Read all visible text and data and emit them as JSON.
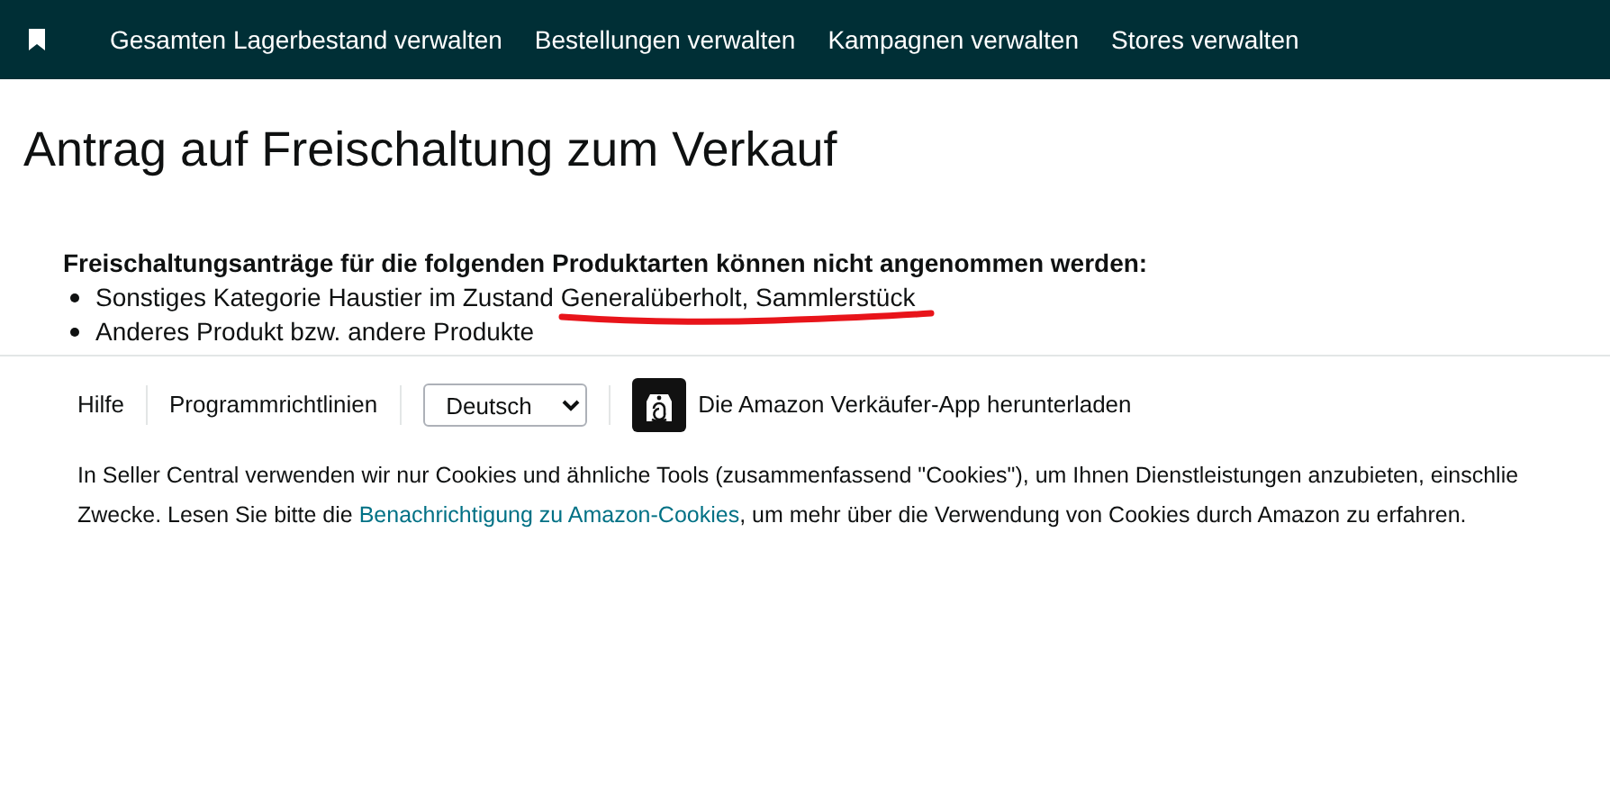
{
  "nav": {
    "items": [
      "Gesamten Lagerbestand verwalten",
      "Bestellungen verwalten",
      "Kampagnen verwalten",
      "Stores verwalten"
    ]
  },
  "title": "Antrag auf Freischaltung zum Verkauf",
  "notice": {
    "heading": "Freischaltungsanträge für die folgenden Produktarten können nicht angenommen werden:",
    "items": [
      "Sonstiges Kategorie Haustier im Zustand Generalüberholt, Sammlerstück",
      "Anderes Produkt bzw. andere Produkte"
    ]
  },
  "footer": {
    "links": [
      "Hilfe",
      "Programmrichtlinien"
    ],
    "language": "Deutsch",
    "app_link": "Die Amazon Verkäufer-App herunterladen"
  },
  "cookie_notice": {
    "line_1": "In Seller Central verwenden wir nur Cookies und ähnliche Tools (zusammenfassend \"Cookies\"), um Ihnen Dienstleistungen anzubieten, einschlie",
    "line_2_before": "Zwecke. Lesen Sie bitte die ",
    "link": "Benachrichtigung zu Amazon-Cookies",
    "line_2_after": ", um mehr über die Verwendung von Cookies durch Amazon zu erfahren."
  }
}
